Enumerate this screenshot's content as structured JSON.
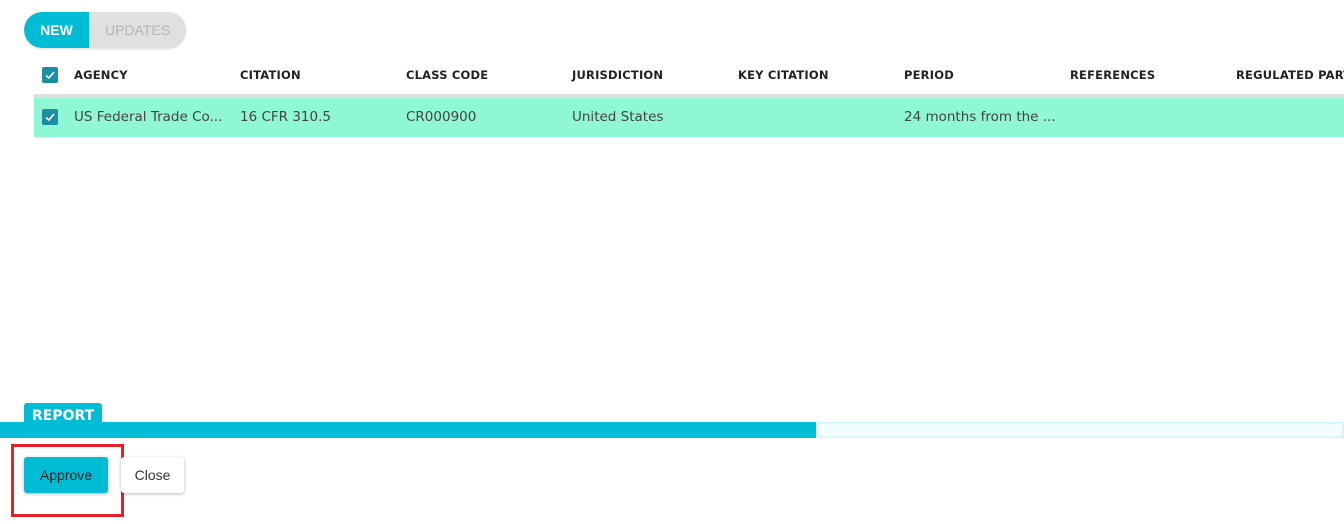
{
  "toggle": {
    "options": [
      "NEW",
      "UPDATES"
    ],
    "selected": "NEW"
  },
  "table": {
    "columns": [
      "AGENCY",
      "CITATION",
      "CLASS CODE",
      "JURISDICTION",
      "KEY CITATION",
      "PERIOD",
      "REFERENCES",
      "REGULATED PARTY"
    ],
    "header_checked": true,
    "rows": [
      {
        "checked": true,
        "cells": [
          "US Federal Trade Co...",
          "16 CFR 310.5",
          "CR000900",
          "United States",
          "",
          "24 months from the ...",
          "",
          ""
        ]
      }
    ]
  },
  "report": {
    "label": "REPORT",
    "progress_fraction": 0.607
  },
  "actions": {
    "approve_label": "Approve",
    "close_label": "Close"
  },
  "colors": {
    "accent": "#00bcd4",
    "row_selected": "#8ff6d6",
    "highlight": "#e4202a",
    "checkbox": "#1a8fa3"
  }
}
